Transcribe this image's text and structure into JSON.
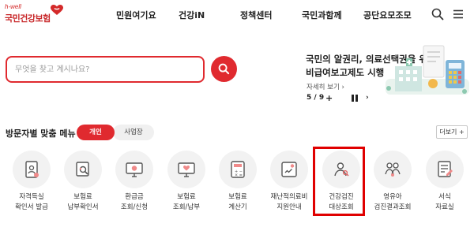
{
  "header": {
    "logo_small": "h-well",
    "logo_main": "국민건강보험",
    "nav": [
      {
        "label": "민원여기요"
      },
      {
        "label": "건강iN"
      },
      {
        "label": "정책센터"
      },
      {
        "label": "국민과함께"
      },
      {
        "label": "공단요모조모"
      }
    ],
    "search_icon": "search-icon",
    "menu_icon": "hamburger-menu-icon"
  },
  "search": {
    "placeholder": "무엇을 찾고 계시나요?",
    "value": "",
    "button_icon": "search-icon",
    "accent": "#e02a2f"
  },
  "banner": {
    "title_line1": "국민의 알권리, 의료선택권을 위해",
    "title_line2": "비급여보고제도 시행",
    "detail_link": "자세히 보기 ›",
    "pager_count": "5 / 9",
    "pager_plus": "+",
    "pager_next": "›"
  },
  "menu_section": {
    "title": "방문자별 맞춤 메뉴",
    "tabs": [
      {
        "label": "개인",
        "active": true
      },
      {
        "label": "사업장",
        "active": false
      }
    ],
    "more_label": "더보기 +",
    "items": [
      {
        "line1": "자격득실",
        "line2": "확인서 발급",
        "icon": "id-card-icon"
      },
      {
        "line1": "보험료",
        "line2": "납부확인서",
        "icon": "document-search-icon"
      },
      {
        "line1": "환급금",
        "line2": "조회/신청",
        "icon": "monitor-refund-icon"
      },
      {
        "line1": "보험료",
        "line2": "조회/납부",
        "icon": "monitor-payment-icon"
      },
      {
        "line1": "보험료",
        "line2": "계산기",
        "icon": "calculator-icon"
      },
      {
        "line1": "재난적의료비",
        "line2": "지원안내",
        "icon": "medical-support-icon"
      },
      {
        "line1": "건강검진",
        "line2": "대상조회",
        "icon": "person-search-icon"
      },
      {
        "line1": "영유아",
        "line2": "검진결과조회",
        "icon": "family-icon"
      },
      {
        "line1": "서식",
        "line2": "자료실",
        "icon": "form-document-icon"
      }
    ],
    "highlight_color": "#e00000"
  }
}
